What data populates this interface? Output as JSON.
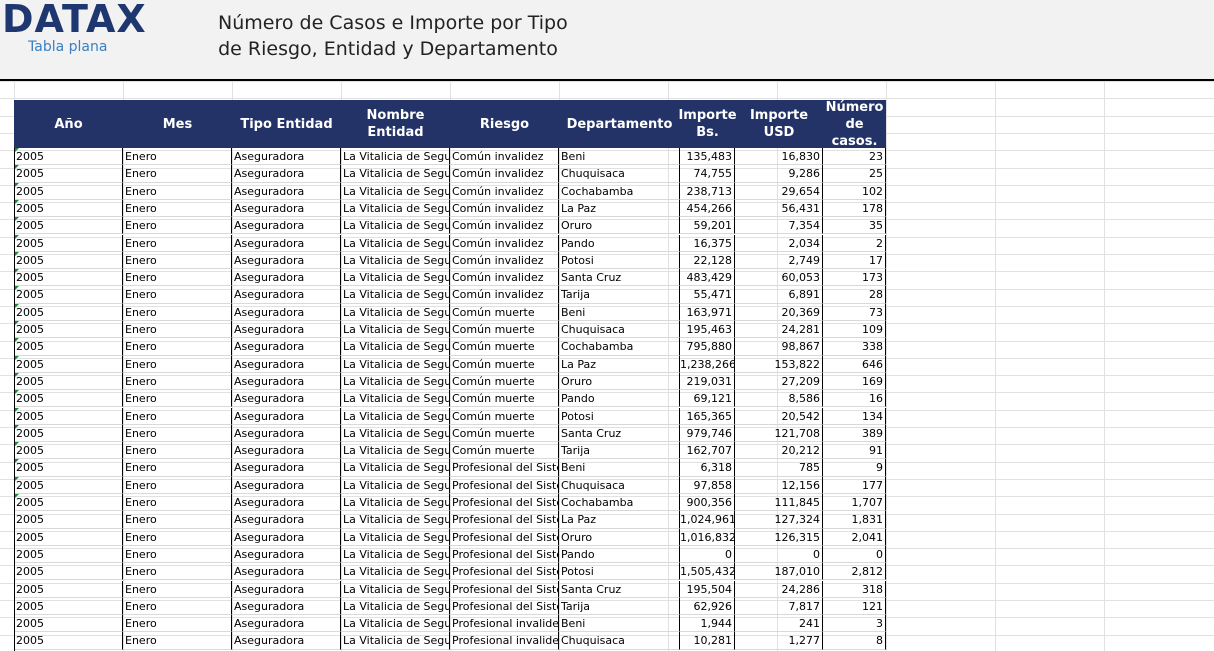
{
  "header": {
    "logo": "DATAX",
    "logo_sub": "Tabla plana",
    "title_line1": "Número de Casos e Importe por Tipo",
    "title_line2": "de Riesgo, Entidad y Departamento"
  },
  "table": {
    "columns": [
      "Año",
      "Mes",
      "Tipo Entidad",
      "Nombre Entidad",
      "Riesgo",
      "Departamento",
      "Importe Bs.",
      "Importe USD",
      "Número de casos."
    ],
    "rows": [
      [
        "2005",
        "Enero",
        "Aseguradora",
        "La Vitalicia de Seguros",
        "Común invalidez",
        "Beni",
        "135,483",
        "16,830",
        "23"
      ],
      [
        "2005",
        "Enero",
        "Aseguradora",
        "La Vitalicia de Seguros",
        "Común invalidez",
        "Chuquisaca",
        "74,755",
        "9,286",
        "25"
      ],
      [
        "2005",
        "Enero",
        "Aseguradora",
        "La Vitalicia de Seguros",
        "Común invalidez",
        "Cochabamba",
        "238,713",
        "29,654",
        "102"
      ],
      [
        "2005",
        "Enero",
        "Aseguradora",
        "La Vitalicia de Seguros",
        "Común invalidez",
        "La Paz",
        "454,266",
        "56,431",
        "178"
      ],
      [
        "2005",
        "Enero",
        "Aseguradora",
        "La Vitalicia de Seguros",
        "Común invalidez",
        "Oruro",
        "59,201",
        "7,354",
        "35"
      ],
      [
        "2005",
        "Enero",
        "Aseguradora",
        "La Vitalicia de Seguros",
        "Común invalidez",
        "Pando",
        "16,375",
        "2,034",
        "2"
      ],
      [
        "2005",
        "Enero",
        "Aseguradora",
        "La Vitalicia de Seguros",
        "Común invalidez",
        "Potosi",
        "22,128",
        "2,749",
        "17"
      ],
      [
        "2005",
        "Enero",
        "Aseguradora",
        "La Vitalicia de Seguros",
        "Común invalidez",
        "Santa Cruz",
        "483,429",
        "60,053",
        "173"
      ],
      [
        "2005",
        "Enero",
        "Aseguradora",
        "La Vitalicia de Seguros",
        "Común invalidez",
        "Tarija",
        "55,471",
        "6,891",
        "28"
      ],
      [
        "2005",
        "Enero",
        "Aseguradora",
        "La Vitalicia de Seguros",
        "Común muerte",
        "Beni",
        "163,971",
        "20,369",
        "73"
      ],
      [
        "2005",
        "Enero",
        "Aseguradora",
        "La Vitalicia de Seguros",
        "Común muerte",
        "Chuquisaca",
        "195,463",
        "24,281",
        "109"
      ],
      [
        "2005",
        "Enero",
        "Aseguradora",
        "La Vitalicia de Seguros",
        "Común muerte",
        "Cochabamba",
        "795,880",
        "98,867",
        "338"
      ],
      [
        "2005",
        "Enero",
        "Aseguradora",
        "La Vitalicia de Seguros",
        "Común muerte",
        "La Paz",
        "1,238,266",
        "153,822",
        "646"
      ],
      [
        "2005",
        "Enero",
        "Aseguradora",
        "La Vitalicia de Seguros",
        "Común muerte",
        "Oruro",
        "219,031",
        "27,209",
        "169"
      ],
      [
        "2005",
        "Enero",
        "Aseguradora",
        "La Vitalicia de Seguros",
        "Común muerte",
        "Pando",
        "69,121",
        "8,586",
        "16"
      ],
      [
        "2005",
        "Enero",
        "Aseguradora",
        "La Vitalicia de Seguros",
        "Común muerte",
        "Potosi",
        "165,365",
        "20,542",
        "134"
      ],
      [
        "2005",
        "Enero",
        "Aseguradora",
        "La Vitalicia de Seguros",
        "Común muerte",
        "Santa Cruz",
        "979,746",
        "121,708",
        "389"
      ],
      [
        "2005",
        "Enero",
        "Aseguradora",
        "La Vitalicia de Seguros",
        "Común muerte",
        "Tarija",
        "162,707",
        "20,212",
        "91"
      ],
      [
        "2005",
        "Enero",
        "Aseguradora",
        "La Vitalicia de Seguros",
        "Profesional del Sistema",
        "Beni",
        "6,318",
        "785",
        "9"
      ],
      [
        "2005",
        "Enero",
        "Aseguradora",
        "La Vitalicia de Seguros",
        "Profesional del Sistema",
        "Chuquisaca",
        "97,858",
        "12,156",
        "177"
      ],
      [
        "2005",
        "Enero",
        "Aseguradora",
        "La Vitalicia de Seguros",
        "Profesional del Sistema",
        "Cochabamba",
        "900,356",
        "111,845",
        "1,707"
      ],
      [
        "2005",
        "Enero",
        "Aseguradora",
        "La Vitalicia de Seguros",
        "Profesional del Sistema",
        "La Paz",
        "1,024,961",
        "127,324",
        "1,831"
      ],
      [
        "2005",
        "Enero",
        "Aseguradora",
        "La Vitalicia de Seguros",
        "Profesional del Sistema",
        "Oruro",
        "1,016,832",
        "126,315",
        "2,041"
      ],
      [
        "2005",
        "Enero",
        "Aseguradora",
        "La Vitalicia de Seguros",
        "Profesional del Sistema",
        "Pando",
        "0",
        "0",
        "0"
      ],
      [
        "2005",
        "Enero",
        "Aseguradora",
        "La Vitalicia de Seguros",
        "Profesional del Sistema",
        "Potosi",
        "1,505,432",
        "187,010",
        "2,812"
      ],
      [
        "2005",
        "Enero",
        "Aseguradora",
        "La Vitalicia de Seguros",
        "Profesional del Sistema",
        "Santa Cruz",
        "195,504",
        "24,286",
        "318"
      ],
      [
        "2005",
        "Enero",
        "Aseguradora",
        "La Vitalicia de Seguros",
        "Profesional del Sistema",
        "Tarija",
        "62,926",
        "7,817",
        "121"
      ],
      [
        "2005",
        "Enero",
        "Aseguradora",
        "La Vitalicia de Seguros",
        "Profesional invalidez",
        "Beni",
        "1,944",
        "241",
        "3"
      ],
      [
        "2005",
        "Enero",
        "Aseguradora",
        "La Vitalicia de Seguros",
        "Profesional invalidez",
        "Chuquisaca",
        "10,281",
        "1,277",
        "8"
      ]
    ]
  },
  "colors": {
    "header_bg": "#233367",
    "logo": "#1f3770",
    "logo_sub": "#3a7fc1",
    "error_indicator": "#1a8a3a"
  }
}
